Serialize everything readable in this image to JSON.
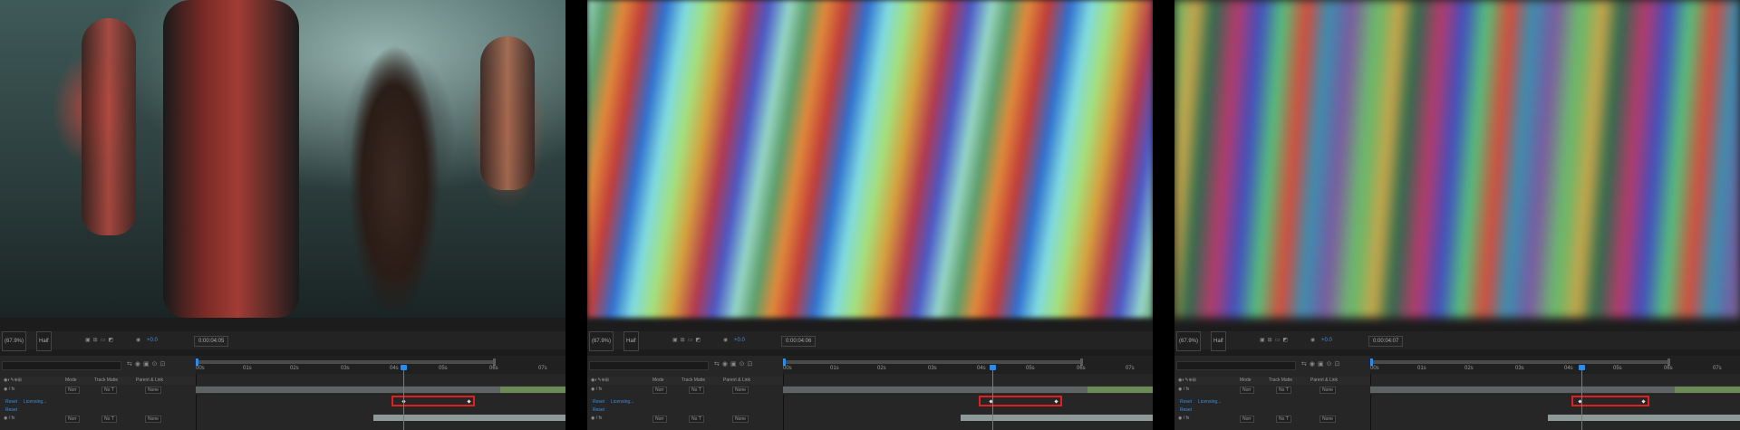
{
  "panels": [
    {
      "frame_description": "boxer",
      "toolbar": {
        "zoom": "(67.9%)",
        "resolution": "Half",
        "exposure": "+0.0",
        "timecode": "0:00:04:05"
      },
      "ruler": [
        "00s",
        "01s",
        "02s",
        "03s",
        "04s",
        "05s",
        "06s",
        "07s"
      ],
      "layers": {
        "reset_labels": [
          "Reset",
          "Licensing..."
        ],
        "reset2": "Reset",
        "mode": "Norr",
        "trkmat": "No Ṫ",
        "parent": "None"
      }
    },
    {
      "frame_description": "streaks",
      "toolbar": {
        "zoom": "(67.9%)",
        "resolution": "Half",
        "exposure": "+0.0",
        "timecode": "0:00:04:06"
      },
      "ruler": [
        "00s",
        "01s",
        "02s",
        "03s",
        "04s",
        "05s",
        "06s",
        "07s"
      ],
      "layers": {
        "reset_labels": [
          "Reset",
          "Licensing..."
        ],
        "reset2": "Reset",
        "mode": "Norr",
        "trkmat": "No Ṫ",
        "parent": "None"
      }
    },
    {
      "frame_description": "streaks-blurred",
      "toolbar": {
        "zoom": "(67.9%)",
        "resolution": "Half",
        "exposure": "+0.0",
        "timecode": "0:00:04:07"
      },
      "ruler": [
        "00s",
        "01s",
        "02s",
        "03s",
        "04s",
        "05s",
        "06s",
        "07s"
      ],
      "layers": {
        "reset_labels": [
          "Reset",
          "Licensing..."
        ],
        "reset2": "Reset",
        "mode": "Norr",
        "trkmat": "No Ṫ",
        "parent": "None"
      }
    }
  ],
  "column_headers": {
    "mode": "Mode",
    "track_matte": "Track Matte",
    "parent": "Parent & Link"
  },
  "colors": {
    "accent": "#2d8ceb",
    "highlight": "#e0201c",
    "track_green": "#6c8a55"
  },
  "icons": [
    "search-icon",
    "camera-icon",
    "playhead-icon",
    "keyframe-icon"
  ]
}
